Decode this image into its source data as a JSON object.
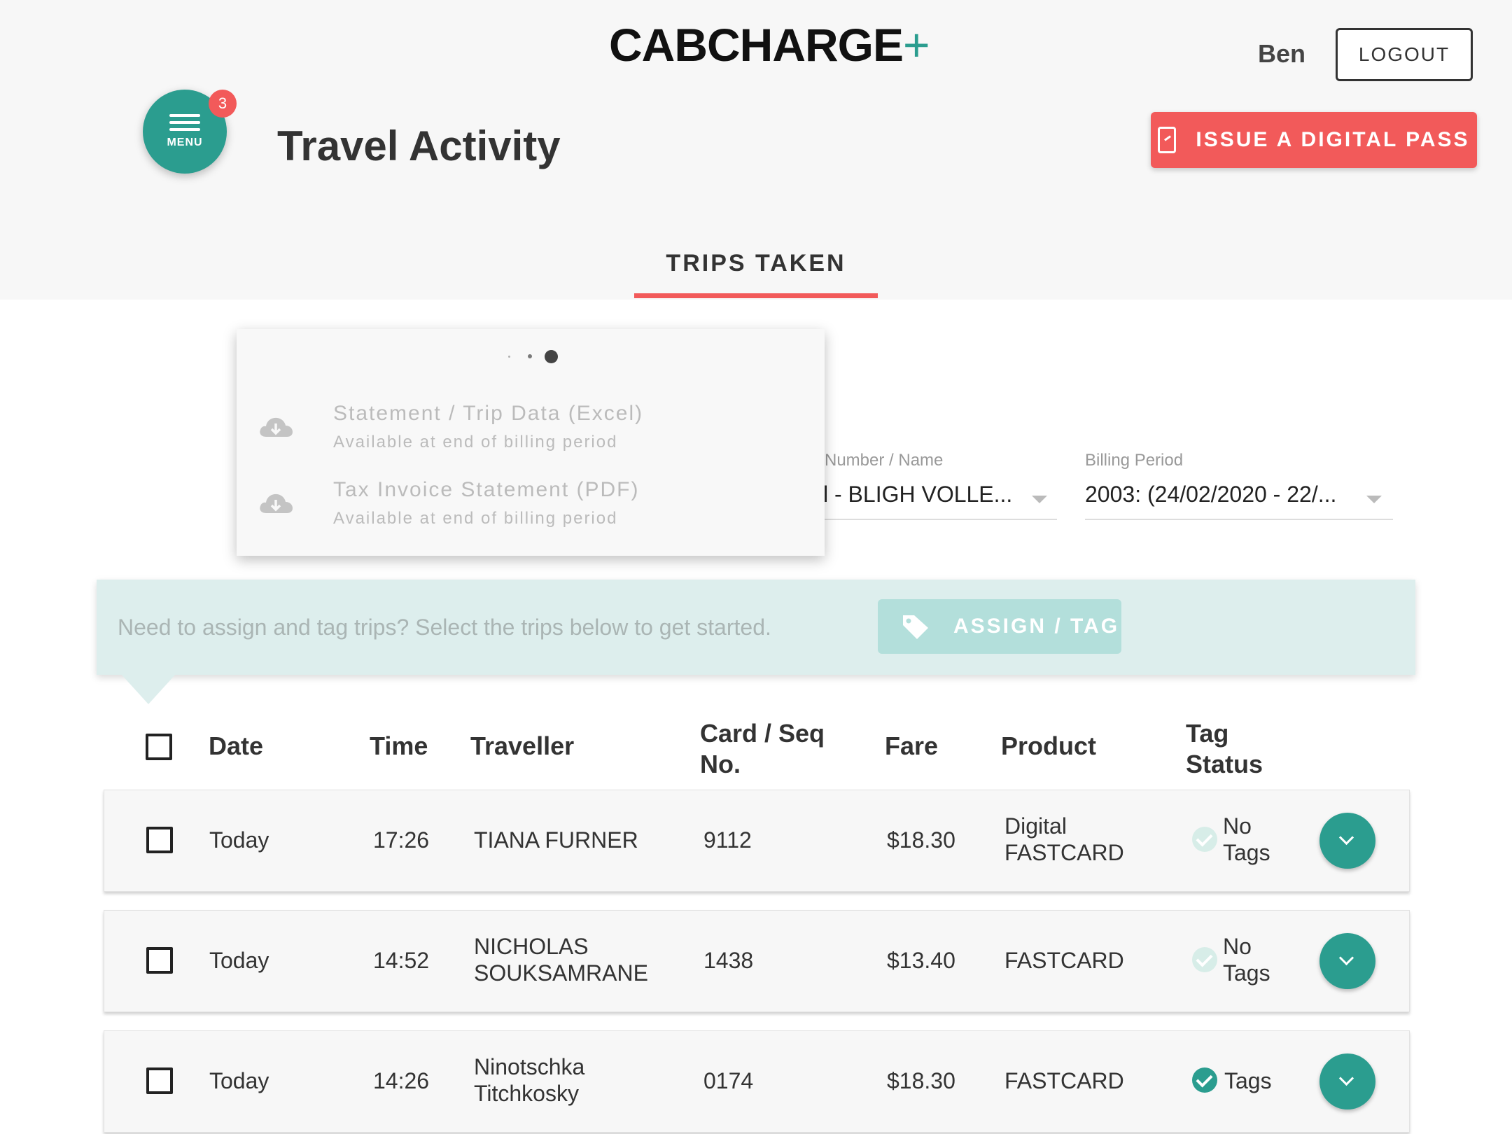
{
  "header": {
    "logo_text": "CABCHARGE",
    "logo_plus": "+",
    "user_name": "Ben",
    "logout_label": "LOGOUT",
    "menu_label": "MENU",
    "menu_badge": "3",
    "page_title": "Travel Activity",
    "issue_pass_label": "ISSUE A DIGITAL PASS"
  },
  "tabs": [
    {
      "label": "TRIPS TAKEN",
      "active": true
    }
  ],
  "filters": {
    "account": {
      "label": "Number / Name",
      "value": "l  - BLIGH VOLLE..."
    },
    "billing": {
      "label": "Billing Period",
      "value": "2003: (24/02/2020 - 22/..."
    }
  },
  "downloads": {
    "items": [
      {
        "title": "Statement / Trip Data (Excel)",
        "subtitle": "Available at end of billing period"
      },
      {
        "title": "Tax Invoice Statement (PDF)",
        "subtitle": "Available at end of billing period"
      }
    ]
  },
  "assign": {
    "prompt": "Need to assign and tag trips? Select the trips below to get started.",
    "button_label": "ASSIGN / TAG"
  },
  "table": {
    "headers": {
      "date": "Date",
      "time": "Time",
      "traveller": "Traveller",
      "card_line1": "Card / Seq",
      "card_line2": "No.",
      "fare": "Fare",
      "product": "Product",
      "tag_line1": "Tag",
      "tag_line2": "Status"
    },
    "rows": [
      {
        "date": "Today",
        "time": "17:26",
        "traveller_1": "TIANA FURNER",
        "traveller_2": "",
        "card": "9112",
        "fare": "$18.30",
        "product_1": "Digital",
        "product_2": "FASTCARD",
        "tag_1": "No",
        "tag_2": "Tags",
        "tagged": false
      },
      {
        "date": "Today",
        "time": "14:52",
        "traveller_1": "NICHOLAS",
        "traveller_2": "SOUKSAMRANE",
        "card": "1438",
        "fare": "$13.40",
        "product_1": "FASTCARD",
        "product_2": "",
        "tag_1": "No",
        "tag_2": "Tags",
        "tagged": false
      },
      {
        "date": "Today",
        "time": "14:26",
        "traveller_1": "Ninotschka",
        "traveller_2": "Titchkosky",
        "card": "0174",
        "fare": "$18.30",
        "product_1": "FASTCARD",
        "product_2": "",
        "tag_1": "Tags",
        "tag_2": "",
        "tagged": true
      }
    ]
  },
  "colors": {
    "accent_teal": "#2b9d8f",
    "accent_red": "#f25a5a",
    "assign_bg": "#ddeeed"
  },
  "icons": [
    "menu-icon",
    "digital-pass-icon",
    "cloud-download-icon",
    "tag-icon",
    "check-circle-icon",
    "chevron-down-icon"
  ]
}
